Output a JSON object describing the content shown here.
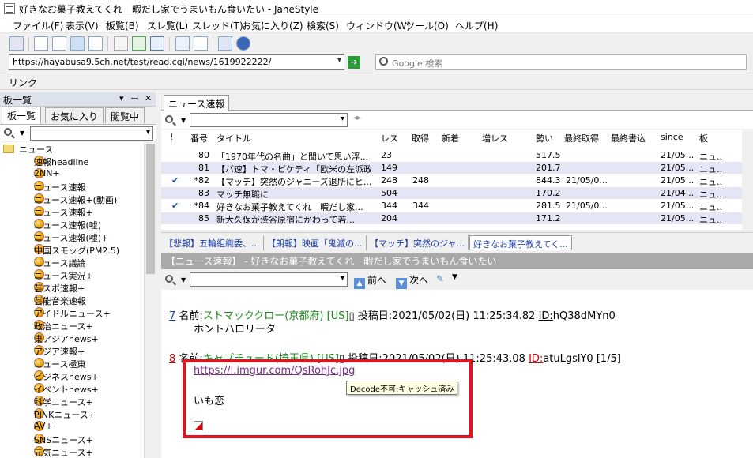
{
  "window": {
    "title": "好きなお菓子教えてくれ　暇だし家でうまいもん食いたい - JaneStyle"
  },
  "menu": [
    "ファイル(F)",
    "表示(V)",
    "板覧(B)",
    "スレ覧(L)",
    "スレッド(T)",
    "お気に入り(Z)",
    "検索(S)",
    "ウィンドウ(W)",
    "ツール(O)",
    "ヘルプ(H)"
  ],
  "toolbar": {
    "icons": [
      "board-icon",
      "pane1-icon",
      "pane2-icon",
      "pane3-icon",
      "pane4-icon",
      "write-icon",
      "refresh-icon",
      "refresh-all-icon",
      "search-board-icon",
      "search-icon",
      "settings-icon",
      "help-icon"
    ]
  },
  "address": {
    "url": "https://hayabusa9.5ch.net/test/read.cgi/news/1619922222/",
    "search_placeholder": "Google 検索"
  },
  "linkbar": {
    "label": "リンク"
  },
  "left": {
    "header": "板一覧",
    "header_controls": [
      "▾",
      "ꟷ",
      "✕"
    ],
    "tabs": [
      "板一覧",
      "お気に入り",
      "閲覧中"
    ],
    "folder": "ニュース",
    "boards": [
      "速報headline",
      "2NN+",
      "ニュース速報",
      "ニュース速報+(動画)",
      "ニュース速報+",
      "ニュース速報(嘘)",
      "ニュース速報(嘘)+",
      "中国スモッグ(PM2.5)",
      "ニュース議論",
      "ニュース実況+",
      "芸スポ速報+",
      "芸能音楽速報",
      "アイドルニュース+",
      "政治ニュース+",
      "東アジアnews+",
      "アジア速報+",
      "ニュース極東",
      "ビジネスnews+",
      "イベントnews+",
      "科学ニュース+",
      "PINKニュース+",
      "AV+",
      "SNSニュース+",
      "元気ニュース+"
    ]
  },
  "right": {
    "tab": "ニュース速報",
    "columns": [
      "!",
      "番号",
      "タイトル",
      "レス",
      "取得",
      "新着",
      "増レス",
      "勢い",
      "最終取得",
      "最終書込",
      "since",
      "板"
    ],
    "threads": [
      {
        "mark": "",
        "num": "80",
        "title": "「1970年代の名曲」と聞いて思い浮...",
        "res": "23",
        "got": "",
        "new": "",
        "inc": "",
        "power": "517.5",
        "last_get": "",
        "last_write": "",
        "since": "21/05...",
        "board": "ニュ..."
      },
      {
        "mark": "",
        "num": "81",
        "title": "【バ速】トマ・ピケティ「欧米の左派政...",
        "res": "149",
        "got": "",
        "new": "",
        "inc": "",
        "power": "201.7",
        "last_get": "",
        "last_write": "",
        "since": "21/05...",
        "board": "ニュ..."
      },
      {
        "mark": "✔",
        "num": "*82",
        "title": "【マッチ】突然のジャニーズ退所にヒ...",
        "res": "248",
        "got": "248",
        "new": "",
        "inc": "",
        "power": "844.3",
        "last_get": "21/05/0...",
        "last_write": "",
        "since": "21/05...",
        "board": "ニュ..."
      },
      {
        "mark": "",
        "num": "83",
        "title": "マッチ無職に",
        "res": "504",
        "got": "",
        "new": "",
        "inc": "",
        "power": "170.2",
        "last_get": "",
        "last_write": "",
        "since": "21/04...",
        "board": "ニュ..."
      },
      {
        "mark": "✔",
        "num": "*84",
        "title": "好きなお菓子教えてくれ　暇だし家...",
        "res": "344",
        "got": "344",
        "new": "",
        "inc": "",
        "power": "281.5",
        "last_get": "21/05/0...",
        "last_write": "",
        "since": "21/05...",
        "board": "ニュ..."
      },
      {
        "mark": "",
        "num": "85",
        "title": "新大久保が渋谷原宿にかわって若...",
        "res": "204",
        "got": "",
        "new": "",
        "inc": "",
        "power": "171.2",
        "last_get": "",
        "last_write": "",
        "since": "21/05...",
        "board": "ニュ..."
      }
    ],
    "open_tabs": [
      "【悲報】五輪組織委、...",
      "【朗報】映画「鬼滅の...",
      "【マッチ】突然のジャ...",
      "好きなお菓子教えてく..."
    ],
    "thread_title": "【ニュース速報】 - 好きなお菓子教えてくれ　暇だし家でうまいもん食いたい",
    "nav": {
      "prev": "前へ",
      "next": "次へ"
    },
    "posts": [
      {
        "num": "7",
        "label": "名前:",
        "name": "ストマッククロー(京都府) [US]",
        "sep": "▯ 投稿日:",
        "date": "2021/05/02(日) 11:25:34.82",
        "id_label": "ID:",
        "id": "hQ38dMYn0",
        "body": "ホントハロリータ"
      },
      {
        "num": "8",
        "label": "名前:",
        "name": "キャプチュード(埼玉県) [US]",
        "sep": "▯ 投稿日:",
        "date": "2021/05/02(日) 11:25:43.08",
        "id_label": "ID:",
        "id": "atuLgslY0 [1/5]",
        "link": "https://i.imgur.com/QsRohJc.jpg",
        "body": "いも恋"
      }
    ],
    "tooltip": "Decode不可:キャッシュ済み"
  },
  "colors": {
    "highlight_box": "#e0141e",
    "row_alt": "#e4e6f5",
    "link_blue": "#1d3faa",
    "name_green": "#1a8a1a"
  }
}
